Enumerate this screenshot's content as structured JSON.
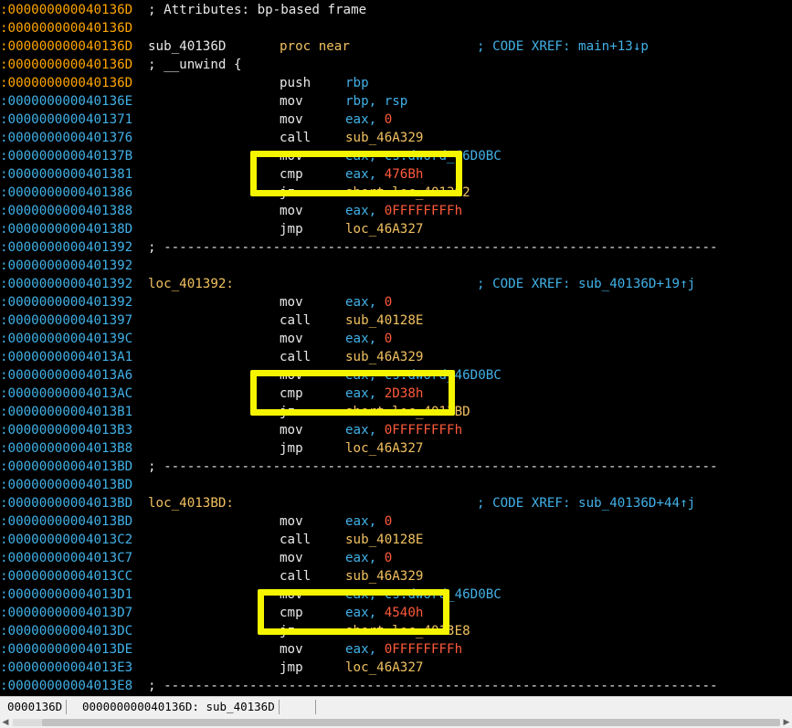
{
  "colors": {
    "background": "#000000",
    "address_func": "#ffa500",
    "address_code": "#41b0e6",
    "mnemonic": "#e8e8e8",
    "operand": "#41b0e6",
    "label": "#f0c060",
    "number": "#ff5a3c",
    "comment": "#41b0e6",
    "highlight": "#f5f500"
  },
  "listing": [
    {
      "addr": ":000000000040136D",
      "kind": "func",
      "label": "; Attributes: bp-based frame",
      "label_color": "#e8e8e8"
    },
    {
      "addr": ":000000000040136D",
      "kind": "func"
    },
    {
      "addr": ":000000000040136D",
      "kind": "func",
      "label": "sub_40136D",
      "label_color": "#e8e8e8",
      "mnem": "proc near",
      "mnem_color": "#f0c060",
      "cmt": "; CODE XREF: main+13↓p"
    },
    {
      "addr": ":000000000040136D",
      "kind": "func",
      "label": "; __unwind {",
      "label_color": "#e8e8e8"
    },
    {
      "addr": ":000000000040136D",
      "kind": "func",
      "mnem": "push",
      "ops": [
        {
          "t": "rbp",
          "c": "#41b0e6"
        }
      ]
    },
    {
      "addr": ":000000000040136E",
      "kind": "code",
      "mnem": "mov",
      "ops": [
        {
          "t": "rbp, rsp",
          "c": "#41b0e6"
        }
      ]
    },
    {
      "addr": ":0000000000401371",
      "kind": "code",
      "mnem": "mov",
      "ops": [
        {
          "t": "eax, ",
          "c": "#41b0e6"
        },
        {
          "t": "0",
          "c": "#ff5a3c"
        }
      ]
    },
    {
      "addr": ":0000000000401376",
      "kind": "code",
      "mnem": "call",
      "ops": [
        {
          "t": "sub_46A329",
          "c": "#f0c060"
        }
      ]
    },
    {
      "addr": ":000000000040137B",
      "kind": "code",
      "mnem": "mov",
      "ops": [
        {
          "t": "eax, cs:dword_46D0BC",
          "c": "#41b0e6"
        }
      ]
    },
    {
      "addr": ":0000000000401381",
      "kind": "code",
      "mnem": "cmp",
      "ops": [
        {
          "t": "eax, ",
          "c": "#41b0e6"
        },
        {
          "t": "476Bh",
          "c": "#ff5a3c"
        }
      ]
    },
    {
      "addr": ":0000000000401386",
      "kind": "code",
      "mnem": "jz",
      "ops": [
        {
          "t": "short loc_401392",
          "c": "#f0c060"
        }
      ]
    },
    {
      "addr": ":0000000000401388",
      "kind": "code",
      "mnem": "mov",
      "ops": [
        {
          "t": "eax, ",
          "c": "#41b0e6"
        },
        {
          "t": "0FFFFFFFFh",
          "c": "#ff5a3c"
        }
      ]
    },
    {
      "addr": ":000000000040138D",
      "kind": "code",
      "mnem": "jmp",
      "ops": [
        {
          "t": "loc_46A327",
          "c": "#f0c060"
        }
      ]
    },
    {
      "addr": ":0000000000401392",
      "kind": "code",
      "sep": "; -----------------------------------------------------------------------"
    },
    {
      "addr": ":0000000000401392",
      "kind": "code"
    },
    {
      "addr": ":0000000000401392",
      "kind": "code",
      "label": "loc_401392:",
      "label_color": "#f0c060",
      "cmt": "; CODE XREF: sub_40136D+19↑j"
    },
    {
      "addr": ":0000000000401392",
      "kind": "code",
      "mnem": "mov",
      "ops": [
        {
          "t": "eax, ",
          "c": "#41b0e6"
        },
        {
          "t": "0",
          "c": "#ff5a3c"
        }
      ]
    },
    {
      "addr": ":0000000000401397",
      "kind": "code",
      "mnem": "call",
      "ops": [
        {
          "t": "sub_40128E",
          "c": "#f0c060"
        }
      ]
    },
    {
      "addr": ":000000000040139C",
      "kind": "code",
      "mnem": "mov",
      "ops": [
        {
          "t": "eax, ",
          "c": "#41b0e6"
        },
        {
          "t": "0",
          "c": "#ff5a3c"
        }
      ]
    },
    {
      "addr": ":00000000004013A1",
      "kind": "code",
      "mnem": "call",
      "ops": [
        {
          "t": "sub_46A329",
          "c": "#f0c060"
        }
      ]
    },
    {
      "addr": ":00000000004013A6",
      "kind": "code",
      "mnem": "mov",
      "ops": [
        {
          "t": "eax, cs:dword_46D0BC",
          "c": "#41b0e6"
        }
      ]
    },
    {
      "addr": ":00000000004013AC",
      "kind": "code",
      "mnem": "cmp",
      "ops": [
        {
          "t": "eax, ",
          "c": "#41b0e6"
        },
        {
          "t": "2D38h",
          "c": "#ff5a3c"
        }
      ]
    },
    {
      "addr": ":00000000004013B1",
      "kind": "code",
      "mnem": "jz",
      "ops": [
        {
          "t": "short loc_4013BD",
          "c": "#f0c060"
        }
      ]
    },
    {
      "addr": ":00000000004013B3",
      "kind": "code",
      "mnem": "mov",
      "ops": [
        {
          "t": "eax, ",
          "c": "#41b0e6"
        },
        {
          "t": "0FFFFFFFFh",
          "c": "#ff5a3c"
        }
      ]
    },
    {
      "addr": ":00000000004013B8",
      "kind": "code",
      "mnem": "jmp",
      "ops": [
        {
          "t": "loc_46A327",
          "c": "#f0c060"
        }
      ]
    },
    {
      "addr": ":00000000004013BD",
      "kind": "code",
      "sep": "; -----------------------------------------------------------------------"
    },
    {
      "addr": ":00000000004013BD",
      "kind": "code"
    },
    {
      "addr": ":00000000004013BD",
      "kind": "code",
      "label": "loc_4013BD:",
      "label_color": "#f0c060",
      "cmt": "; CODE XREF: sub_40136D+44↑j"
    },
    {
      "addr": ":00000000004013BD",
      "kind": "code",
      "mnem": "mov",
      "ops": [
        {
          "t": "eax, ",
          "c": "#41b0e6"
        },
        {
          "t": "0",
          "c": "#ff5a3c"
        }
      ]
    },
    {
      "addr": ":00000000004013C2",
      "kind": "code",
      "mnem": "call",
      "ops": [
        {
          "t": "sub_40128E",
          "c": "#f0c060"
        }
      ]
    },
    {
      "addr": ":00000000004013C7",
      "kind": "code",
      "mnem": "mov",
      "ops": [
        {
          "t": "eax, ",
          "c": "#41b0e6"
        },
        {
          "t": "0",
          "c": "#ff5a3c"
        }
      ]
    },
    {
      "addr": ":00000000004013CC",
      "kind": "code",
      "mnem": "call",
      "ops": [
        {
          "t": "sub_46A329",
          "c": "#f0c060"
        }
      ]
    },
    {
      "addr": ":00000000004013D1",
      "kind": "code",
      "mnem": "mov",
      "ops": [
        {
          "t": "eax, cs:dword_46D0BC",
          "c": "#41b0e6"
        }
      ]
    },
    {
      "addr": ":00000000004013D7",
      "kind": "code",
      "mnem": "cmp",
      "ops": [
        {
          "t": "eax, ",
          "c": "#41b0e6"
        },
        {
          "t": "4540h",
          "c": "#ff5a3c"
        }
      ]
    },
    {
      "addr": ":00000000004013DC",
      "kind": "code",
      "mnem": "jz",
      "ops": [
        {
          "t": "short loc_4013E8",
          "c": "#f0c060"
        }
      ]
    },
    {
      "addr": ":00000000004013DE",
      "kind": "code",
      "mnem": "mov",
      "ops": [
        {
          "t": "eax, ",
          "c": "#41b0e6"
        },
        {
          "t": "0FFFFFFFFh",
          "c": "#ff5a3c"
        }
      ]
    },
    {
      "addr": ":00000000004013E3",
      "kind": "code",
      "mnem": "jmp",
      "ops": [
        {
          "t": "loc_46A327",
          "c": "#f0c060"
        }
      ]
    },
    {
      "addr": ":00000000004013E8",
      "kind": "code",
      "sep": "; -----------------------------------------------------------------------"
    }
  ],
  "highlight_rows": [
    9,
    21,
    33
  ],
  "statusbar": {
    "offset": "0000136D",
    "location": "000000000040136D: sub_40136D"
  }
}
